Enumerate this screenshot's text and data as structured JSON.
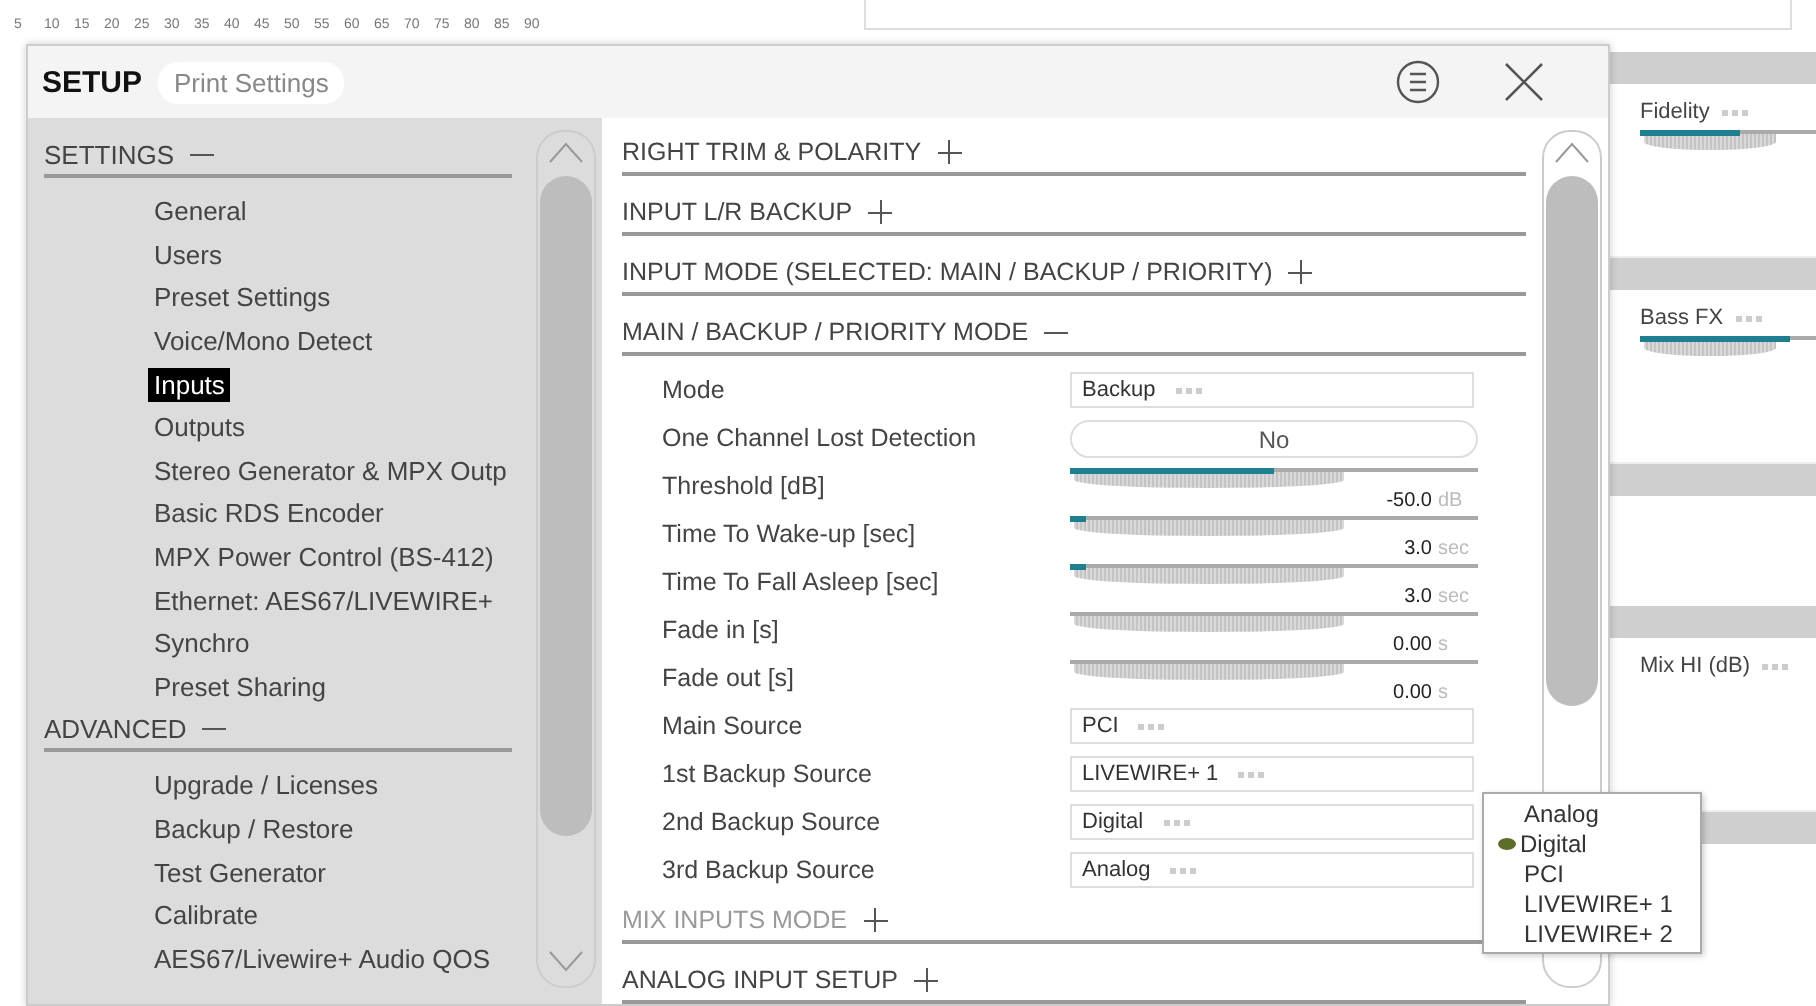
{
  "ruler": {
    "ticks": [
      "5",
      "10",
      "15",
      "20",
      "25",
      "30",
      "35",
      "40",
      "45",
      "50",
      "55",
      "60",
      "65",
      "70",
      "75",
      "80",
      "85",
      "90"
    ]
  },
  "background_panel": {
    "controls": [
      {
        "kind": "slider",
        "label": "Fidelity",
        "level": 0.5
      },
      {
        "kind": "slider",
        "label": "Bass FX",
        "level": 0.75
      },
      {
        "kind": "label",
        "label": "Mix HI (dB)"
      }
    ]
  },
  "dialog": {
    "title": "SETUP",
    "tab": "Print Settings",
    "sidebar": {
      "sections": [
        {
          "title": "SETTINGS",
          "expanded": true,
          "items": [
            {
              "label": "General",
              "selected": false
            },
            {
              "label": "Users",
              "selected": false
            },
            {
              "label": "Preset Settings",
              "selected": false
            },
            {
              "label": "Voice/Mono Detect",
              "selected": false
            },
            {
              "label": "Inputs",
              "selected": true
            },
            {
              "label": "Outputs",
              "selected": false
            },
            {
              "label": "Stereo Generator & MPX Outp",
              "selected": false
            },
            {
              "label": "Basic RDS Encoder",
              "selected": false
            },
            {
              "label": "MPX Power Control (BS-412)",
              "selected": false
            },
            {
              "label": "Ethernet: AES67/LIVEWIRE+",
              "selected": false
            },
            {
              "label": "Synchro",
              "selected": false
            },
            {
              "label": "Preset Sharing",
              "selected": false
            }
          ]
        },
        {
          "title": "ADVANCED",
          "expanded": true,
          "items": [
            {
              "label": "Upgrade / Licenses",
              "selected": false
            },
            {
              "label": "Backup / Restore",
              "selected": false
            },
            {
              "label": "Test Generator",
              "selected": false
            },
            {
              "label": "Calibrate",
              "selected": false
            },
            {
              "label": "AES67/Livewire+ Audio QOS",
              "selected": false
            }
          ]
        }
      ]
    },
    "content": {
      "sections": [
        {
          "title": "RIGHT TRIM & POLARITY",
          "expanded": false
        },
        {
          "title": "INPUT L/R BACKUP",
          "expanded": false
        },
        {
          "title": "INPUT MODE (SELECTED: MAIN / BACKUP / PRIORITY)",
          "expanded": false
        },
        {
          "title": "MAIN / BACKUP / PRIORITY MODE",
          "expanded": true,
          "rows": [
            {
              "kind": "select",
              "label": "Mode",
              "value": "Backup"
            },
            {
              "kind": "toggle",
              "label": "One Channel Lost Detection",
              "value": "No"
            },
            {
              "kind": "slider",
              "label": "Threshold [dB]",
              "level": 0.5,
              "value": "-50.0",
              "unit": "dB"
            },
            {
              "kind": "slider",
              "label": "Time To Wake-up [sec]",
              "level": 0.04,
              "value": "3.0",
              "unit": "sec"
            },
            {
              "kind": "slider",
              "label": "Time To Fall Asleep [sec]",
              "level": 0.04,
              "value": "3.0",
              "unit": "sec"
            },
            {
              "kind": "slider",
              "label": "Fade in [s]",
              "level": 0,
              "value": "0.00",
              "unit": "s"
            },
            {
              "kind": "slider",
              "label": "Fade out [s]",
              "level": 0,
              "value": "0.00",
              "unit": "s"
            },
            {
              "kind": "select",
              "label": "Main Source",
              "value": "PCI"
            },
            {
              "kind": "select",
              "label": "1st Backup Source",
              "value": "LIVEWIRE+ 1"
            },
            {
              "kind": "select",
              "label": "2nd Backup Source",
              "value": "Digital"
            },
            {
              "kind": "select",
              "label": "3rd Backup Source",
              "value": "Analog"
            }
          ]
        },
        {
          "title": "MIX INPUTS MODE",
          "expanded": false
        },
        {
          "title": "ANALOG INPUT SETUP",
          "expanded": false
        }
      ]
    }
  },
  "dropdown": {
    "options": [
      {
        "label": "Analog",
        "selected": false
      },
      {
        "label": "Digital",
        "selected": true
      },
      {
        "label": "PCI",
        "selected": false
      },
      {
        "label": "LIVEWIRE+ 1",
        "selected": false
      },
      {
        "label": "LIVEWIRE+ 2",
        "selected": false
      }
    ]
  }
}
